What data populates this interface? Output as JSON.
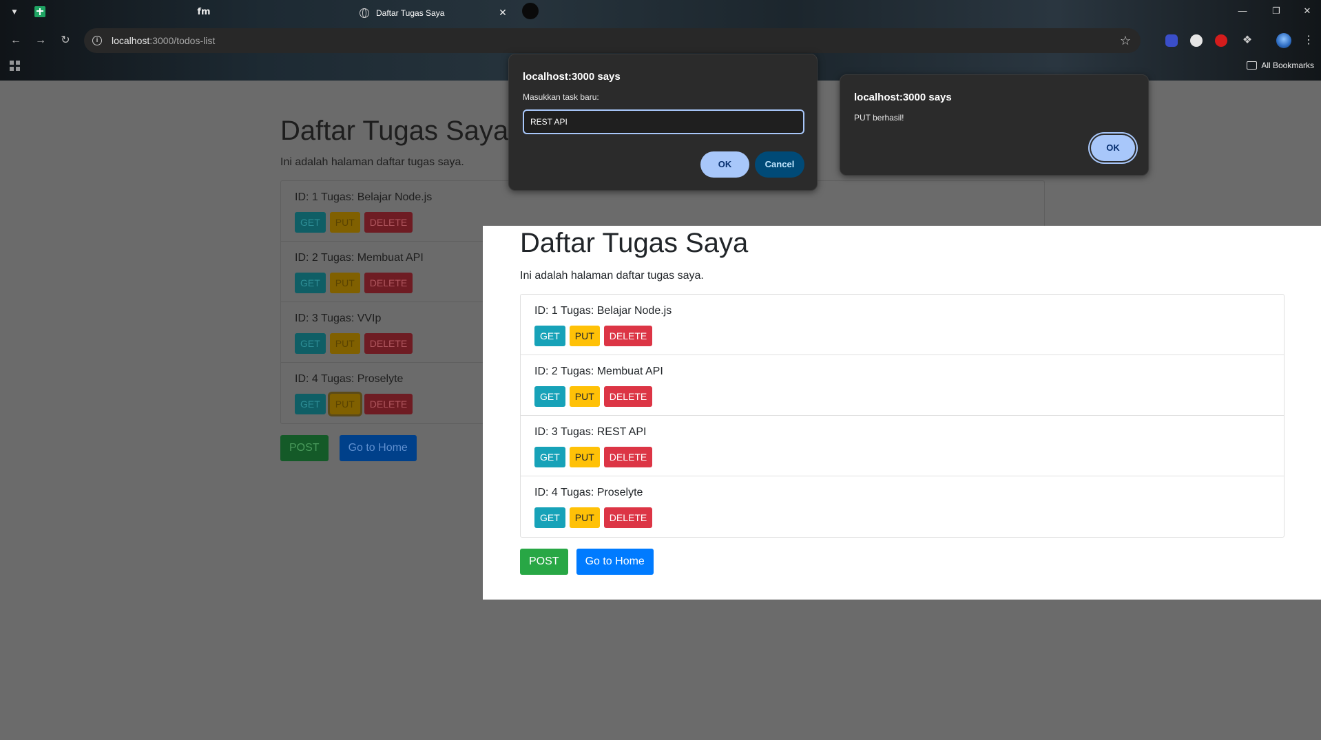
{
  "browser": {
    "tab_title": "Daftar Tugas Saya",
    "pinned_tab_fm": "fm",
    "url_host": "localhost",
    "url_path": ":3000/todos-list",
    "all_bookmarks": "All Bookmarks"
  },
  "page": {
    "heading": "Daftar Tugas Saya",
    "subheading": "Ini adalah halaman daftar tugas saya.",
    "btn_get": "GET",
    "btn_put": "PUT",
    "btn_delete": "DELETE",
    "btn_post": "POST",
    "btn_home": "Go to Home",
    "tasks_before": [
      "ID: 1 Tugas: Belajar Node.js",
      "ID: 2 Tugas: Membuat API",
      "ID: 3 Tugas: VVIp",
      "ID: 4 Tugas: Proselyte"
    ],
    "tasks_after": [
      "ID: 1 Tugas: Belajar Node.js",
      "ID: 2 Tugas: Membuat API",
      "ID: 3 Tugas: REST API",
      "ID: 4 Tugas: Proselyte"
    ]
  },
  "prompt_dialog": {
    "title": "localhost:3000 says",
    "message": "Masukkan task baru:",
    "input_value": "REST API",
    "ok": "OK",
    "cancel": "Cancel"
  },
  "alert_dialog": {
    "title": "localhost:3000 says",
    "message": "PUT berhasil!",
    "ok": "OK"
  }
}
